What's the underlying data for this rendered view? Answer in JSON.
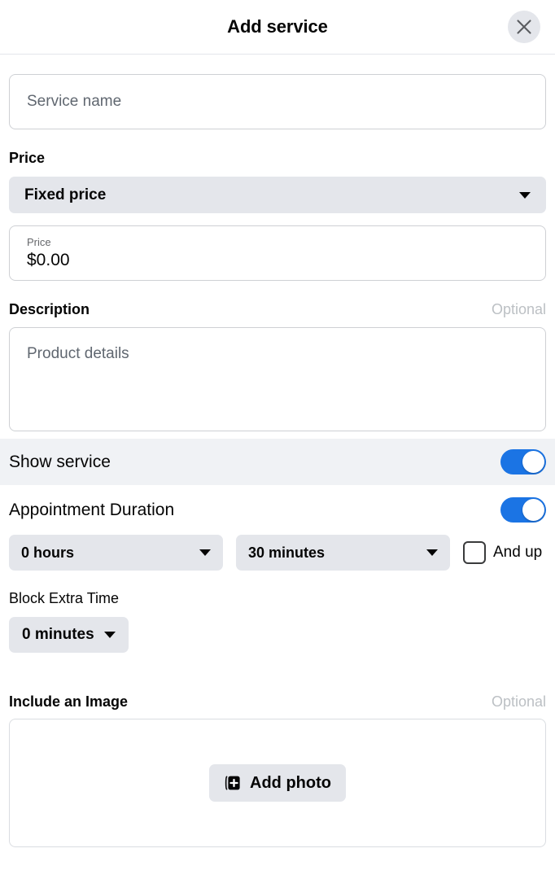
{
  "header": {
    "title": "Add service",
    "close_icon": "close-icon"
  },
  "form": {
    "service_name": {
      "placeholder": "Service name",
      "value": ""
    },
    "price_section": {
      "label": "Price",
      "type_select": {
        "value": "Fixed price",
        "caret_icon": "chevron-down-icon"
      },
      "amount_field": {
        "floating_label": "Price",
        "value": "$0.00"
      }
    },
    "description_section": {
      "label": "Description",
      "optional": "Optional",
      "placeholder": "Product details",
      "value": ""
    },
    "show_service": {
      "label": "Show service",
      "toggle_state": "on"
    },
    "appointment_duration": {
      "label": "Appointment Duration",
      "toggle_state": "on",
      "hours_select": {
        "value": "0 hours",
        "caret_icon": "chevron-down-icon"
      },
      "minutes_select": {
        "value": "30 minutes",
        "caret_icon": "chevron-down-icon"
      },
      "and_up": {
        "label": "And up",
        "checked": "false"
      }
    },
    "block_extra_time": {
      "label": "Block Extra Time",
      "select": {
        "value": "0 minutes",
        "caret_icon": "chevron-down-icon"
      }
    },
    "include_image": {
      "label": "Include an Image",
      "optional": "Optional",
      "add_photo_label": "Add photo",
      "add_photo_icon": "add-photo-icon"
    }
  },
  "colors": {
    "accent_blue": "#1b74e4",
    "surface_gray": "#e4e6eb",
    "band_gray": "#f0f2f5",
    "text_primary": "#050505",
    "text_secondary": "#606770",
    "text_muted": "#bcc0c4",
    "border": "#ced0d4"
  }
}
